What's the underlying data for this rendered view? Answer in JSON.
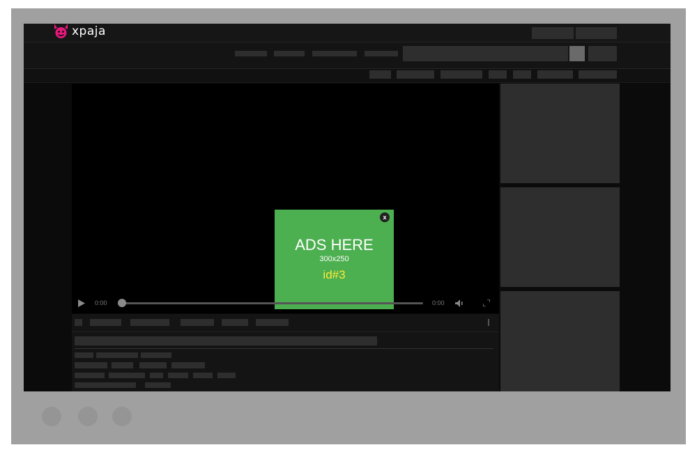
{
  "site": {
    "logo_text": "xpaja",
    "logo_icon": "devil-face-icon"
  },
  "ad": {
    "title": "ADS HERE",
    "size": "300x250",
    "id_label": "id#3",
    "close_label": "x",
    "background_color": "#4caf50",
    "id_color": "#ffeb3b"
  },
  "player": {
    "current_time": "0:00",
    "duration": "0:00",
    "progress": 0,
    "icons": [
      "play-icon",
      "volume-icon",
      "fullscreen-icon",
      "more-options-icon"
    ]
  }
}
